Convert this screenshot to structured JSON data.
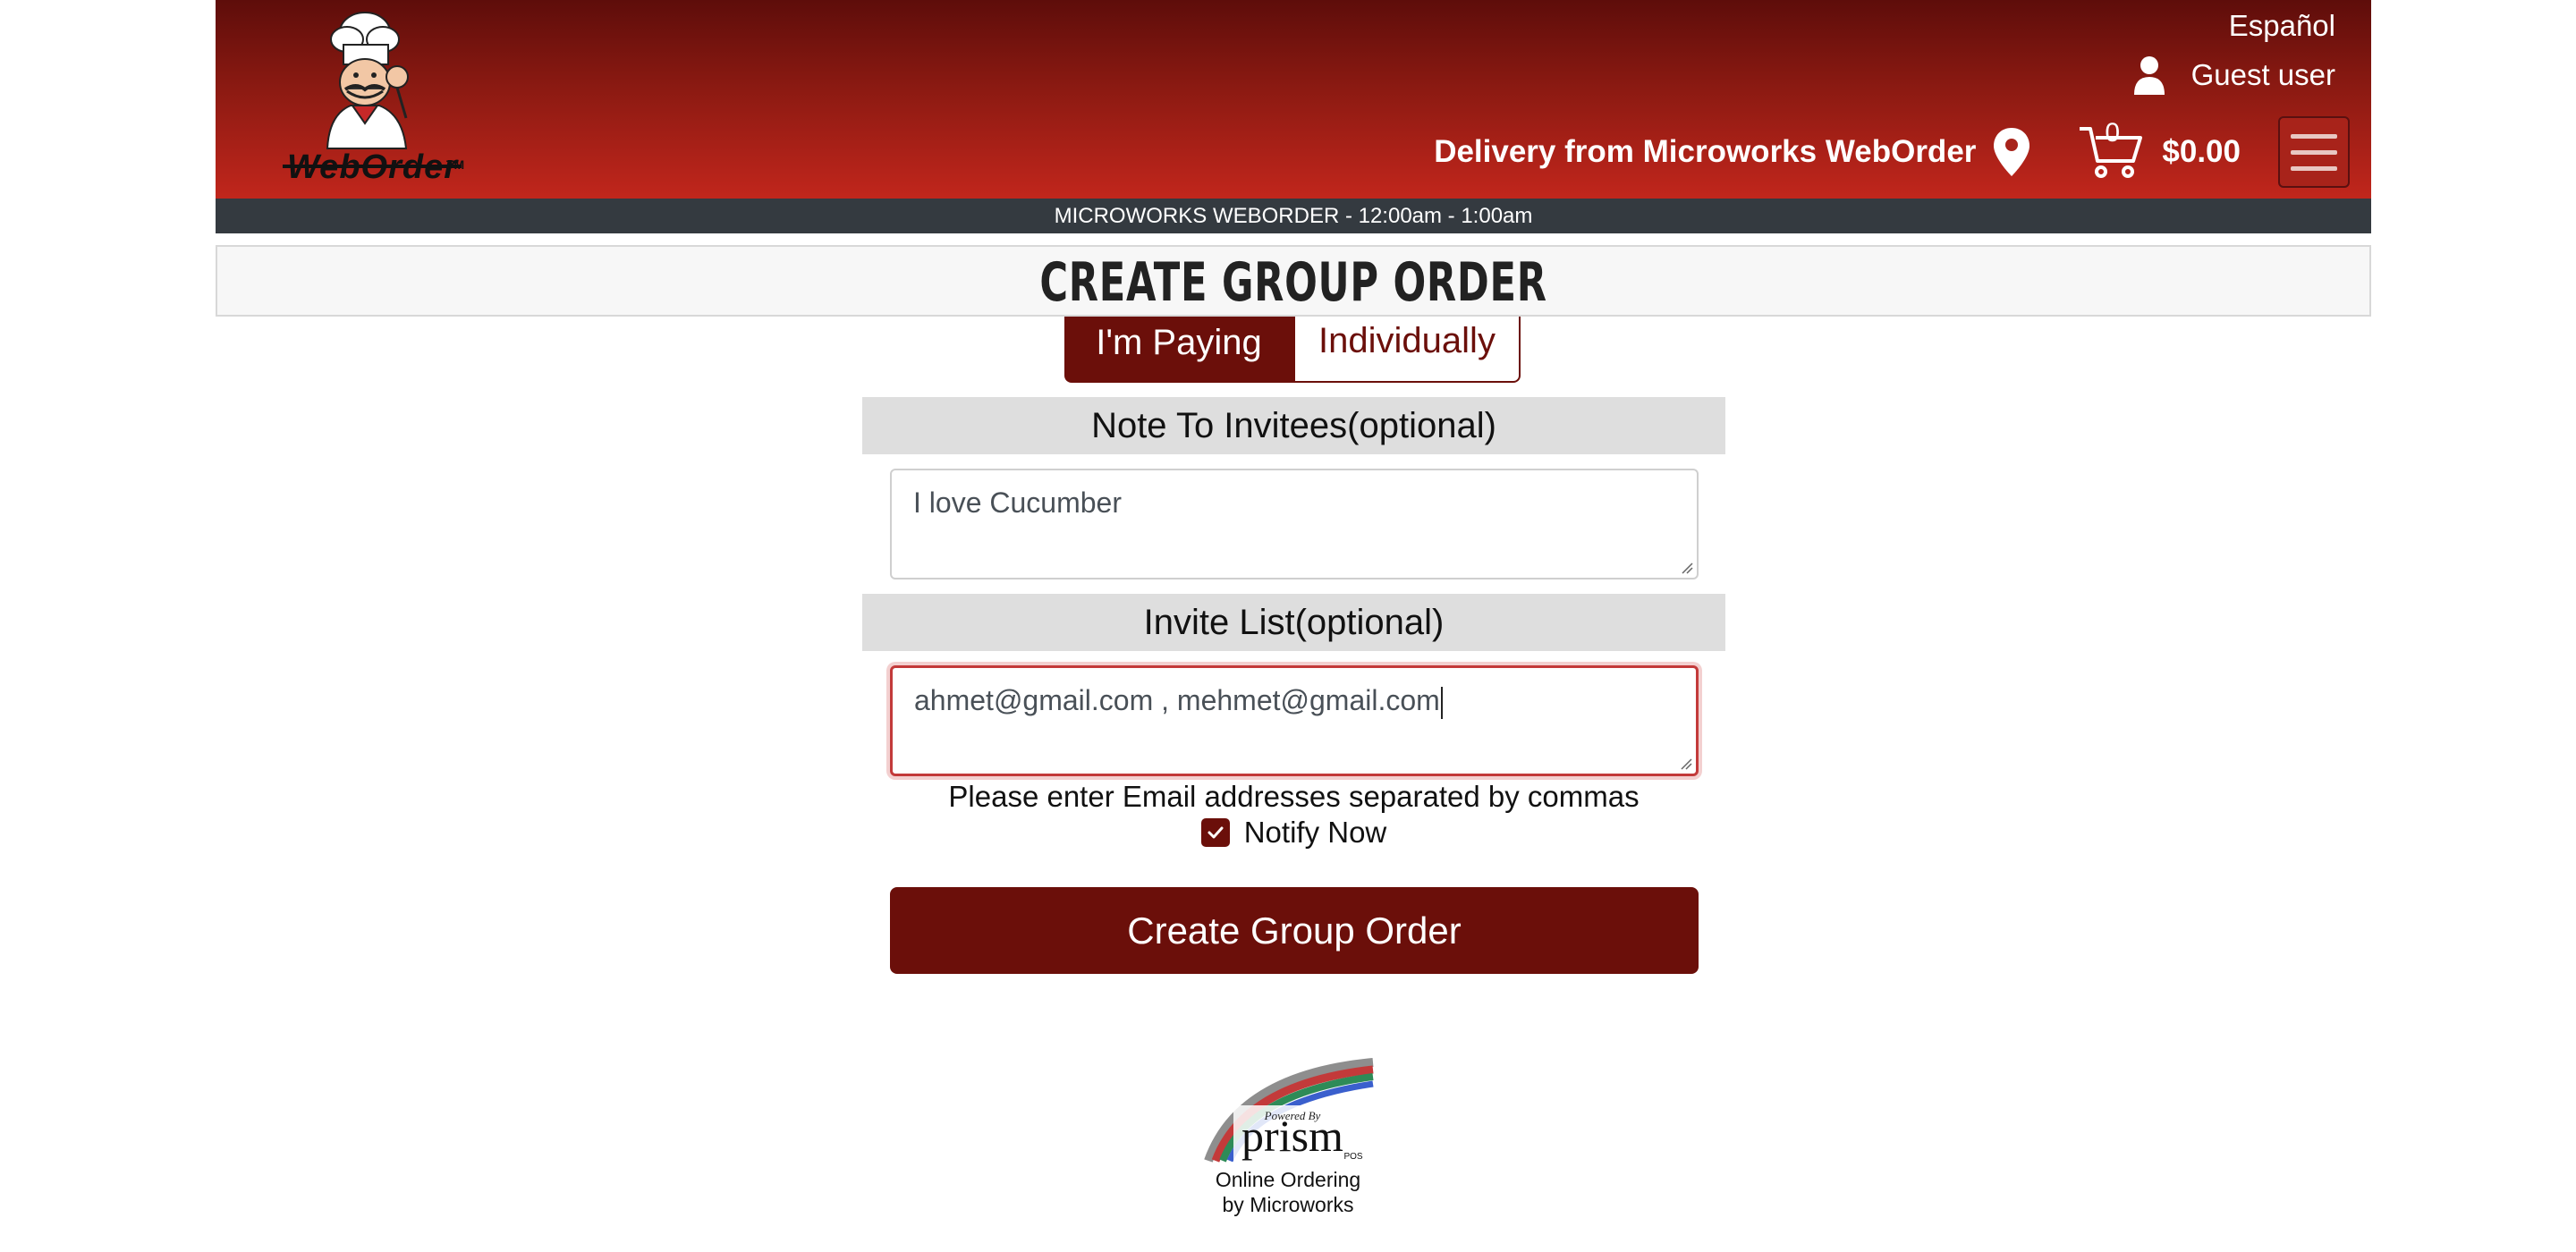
{
  "header": {
    "logo_text": "WebOrder",
    "logo_tm": "TM",
    "language_link": "Español",
    "user_label": "Guest user",
    "delivery_text": "Delivery from Microworks WebOrder",
    "cart_count": "0",
    "cart_total": "$0.00"
  },
  "hours_bar": "MICROWORKS WEBORDER - 12:00am - 1:00am",
  "page_title": "Create Group Order",
  "tabs": [
    {
      "label": "I'm Paying",
      "active": true
    },
    {
      "label": "Individually",
      "active": false
    }
  ],
  "note": {
    "header": "Note To Invitees(optional)",
    "value": "I love Cucumber"
  },
  "invite": {
    "header": "Invite List(optional)",
    "value": "ahmet@gmail.com , mehmet@gmail.com",
    "help": "Please enter Email addresses separated by commas"
  },
  "notify": {
    "label": "Notify Now",
    "checked": true
  },
  "submit_label": "Create Group Order",
  "footer": {
    "logo_powered_by": "Powered By",
    "logo_name": "prism",
    "logo_suffix": "POS",
    "line1": "Online Ordering",
    "line2": "by Microworks"
  },
  "colors": {
    "brand_dark_red": "#6b0f0a",
    "header_red": "#c1261c",
    "hours_bar": "#343a40"
  },
  "icons": [
    "chef-logo-icon",
    "user-icon",
    "location-pin-icon",
    "cart-icon",
    "hamburger-menu-icon",
    "checkmark-icon",
    "resize-grip-icon",
    "prism-pos-logo-icon"
  ]
}
